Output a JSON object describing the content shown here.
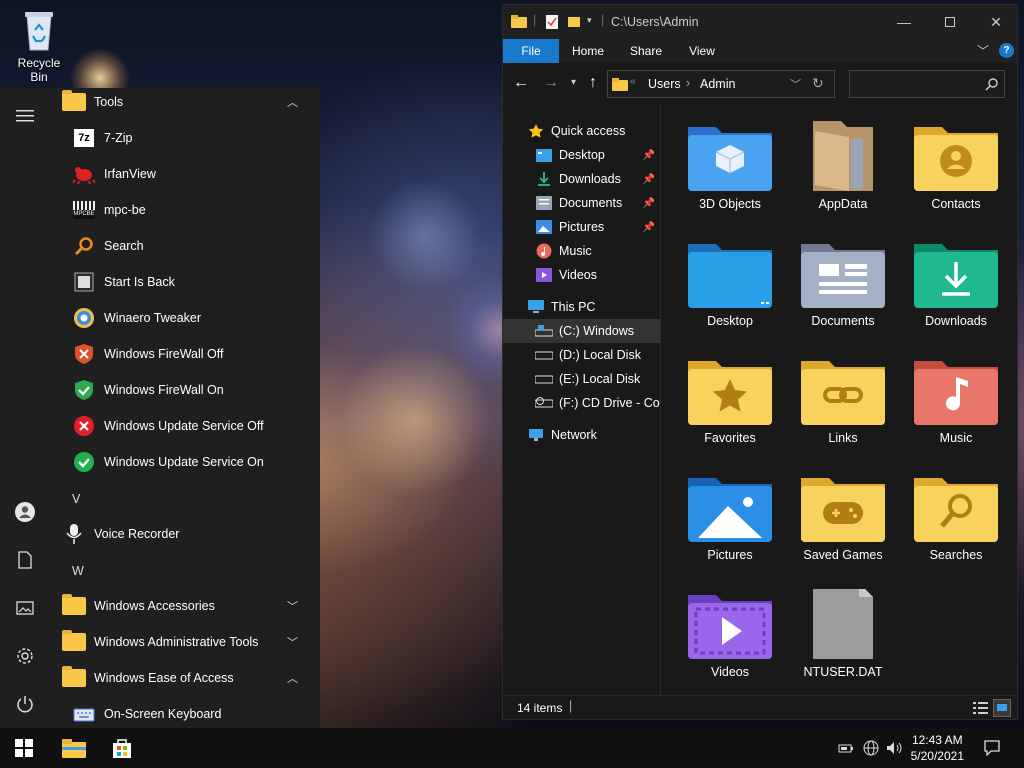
{
  "desktop": {
    "recycle_bin_label": "Recycle Bin"
  },
  "start_menu": {
    "group_tools": "Tools",
    "items_tools": [
      {
        "label": "7-Zip",
        "icon": "7zip-icon"
      },
      {
        "label": "IrfanView",
        "icon": "irfanview-icon"
      },
      {
        "label": "mpc-be",
        "icon": "mpc-be-icon"
      },
      {
        "label": "Search",
        "icon": "search-icon"
      },
      {
        "label": "Start Is Back",
        "icon": "start-is-back-icon"
      },
      {
        "label": "Winaero Tweaker",
        "icon": "winaero-icon"
      },
      {
        "label": "Windows FireWall Off",
        "icon": "firewall-off-icon"
      },
      {
        "label": "Windows FireWall On",
        "icon": "firewall-on-icon"
      },
      {
        "label": "Windows Update Service Off",
        "icon": "update-off-icon"
      },
      {
        "label": "Windows Update Service On",
        "icon": "update-on-icon"
      }
    ],
    "letter_v": "V",
    "voice_recorder": "Voice Recorder",
    "letter_w": "W",
    "group_accessories": "Windows Accessories",
    "group_admin_tools": "Windows Administrative Tools",
    "group_ease_access": "Windows Ease of Access",
    "on_screen_keyboard": "On-Screen Keyboard",
    "mpc_badge": "MPCBE",
    "sevenzip_badge": "7z"
  },
  "explorer": {
    "title_path": "C:\\Users\\Admin",
    "ribbon_tabs": [
      "File",
      "Home",
      "Share",
      "View"
    ],
    "help_glyph": "?",
    "breadcrumb": [
      "Users",
      "Admin"
    ],
    "breadcrumb_overflow": "«",
    "search_placeholder": "",
    "nav": {
      "quick_access": "Quick access",
      "desktop": "Desktop",
      "downloads": "Downloads",
      "documents": "Documents",
      "pictures": "Pictures",
      "music": "Music",
      "videos": "Videos",
      "this_pc": "This PC",
      "c_drive": "(C:) Windows",
      "d_drive": "(D:) Local Disk",
      "e_drive": "(E:) Local Disk",
      "f_drive": "(F:) CD Drive - Com",
      "network": "Network"
    },
    "items": [
      {
        "label": "3D Objects"
      },
      {
        "label": "AppData"
      },
      {
        "label": "Contacts"
      },
      {
        "label": "Desktop"
      },
      {
        "label": "Documents"
      },
      {
        "label": "Downloads"
      },
      {
        "label": "Favorites"
      },
      {
        "label": "Links"
      },
      {
        "label": "Music"
      },
      {
        "label": "Pictures"
      },
      {
        "label": "Saved Games"
      },
      {
        "label": "Searches"
      },
      {
        "label": "Videos"
      },
      {
        "label": "NTUSER.DAT"
      }
    ],
    "status_count": "14 items"
  },
  "taskbar": {
    "time": "12:43 AM",
    "date": "5/20/2021"
  },
  "colors": {
    "accent": "#1979ca",
    "folder": "#f9c846",
    "bg": "#191919"
  }
}
